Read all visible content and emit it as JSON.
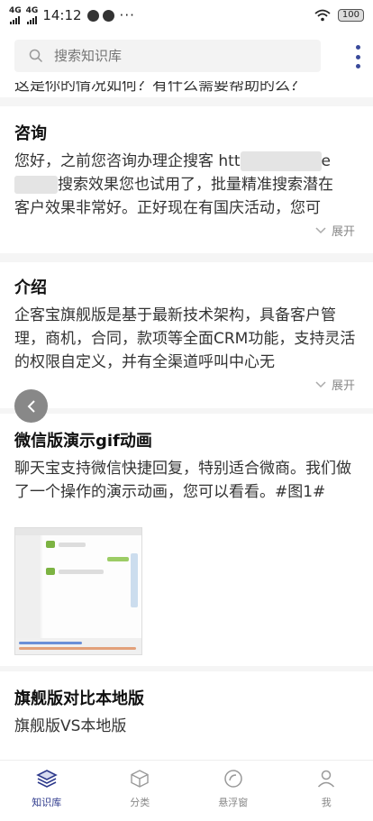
{
  "status_bar": {
    "signal1": "4G",
    "signal2": "4G",
    "time": "14:12",
    "dots": "···",
    "battery": "100"
  },
  "search": {
    "placeholder": "搜索知识库"
  },
  "cutoff_text": "这是你的情况如何？有什么需要帮助的么？",
  "articles": [
    {
      "title": "咨询",
      "body_line1_a": "您好，之前您咨询办理企搜客 htt",
      "body_line1_b": "e",
      "body_line2_a": "搜索效果您也试用了，批量精准搜索潜在",
      "body_line3": "客户效果非常好。正好现在有国庆活动，您可",
      "expand_label": "展开"
    },
    {
      "title": "介绍",
      "body": "企客宝旗舰版是基于最新技术架构，具备客户管理，商机，合同，款项等全面CRM功能，支持灵活的权限自定义，并有全渠道呼叫中心无",
      "expand_label": "展开"
    },
    {
      "title": "微信版演示gif动画",
      "body": "聊天宝支持微信快捷回复，特别适合微商。我们做了一个操作的演示动画，您可以看看。#图1#"
    },
    {
      "title": "旗舰版对比本地版",
      "body": "旗舰版VS本地版"
    }
  ],
  "tabs": [
    {
      "label": "知识库",
      "icon": "layers-icon",
      "active": true
    },
    {
      "label": "分类",
      "icon": "cube-icon",
      "active": false
    },
    {
      "label": "悬浮窗",
      "icon": "float-window-icon",
      "active": false
    },
    {
      "label": "我",
      "icon": "person-icon",
      "active": false
    }
  ],
  "colors": {
    "accent": "#2e3a8c",
    "inactive": "#888888",
    "separator": "#f5f5f5"
  }
}
